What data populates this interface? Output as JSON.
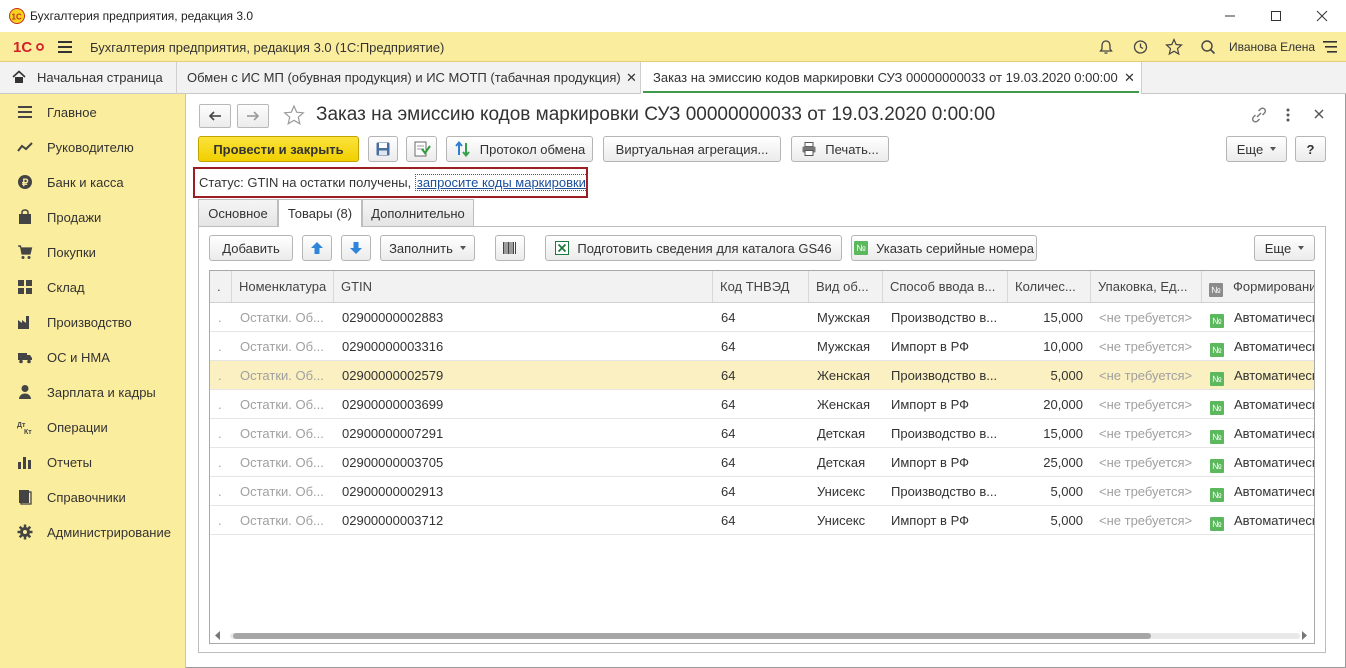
{
  "window": {
    "title": "Бухгалтерия предприятия, редакция 3.0"
  },
  "appbar": {
    "title": "Бухгалтерия предприятия, редакция 3.0  (1С:Предприятие)",
    "user": "Иванова Елена"
  },
  "tabs": [
    {
      "label": "Начальная страница"
    },
    {
      "label": "Обмен с ИС МП (обувная продукция) и ИС МОТП (табачная продукция)"
    },
    {
      "label": "Заказ на эмиссию кодов маркировки СУЗ 00000000033 от 19.03.2020 0:00:00"
    }
  ],
  "sidebar": {
    "items": [
      {
        "label": "Главное",
        "icon": "list-icon"
      },
      {
        "label": "Руководителю",
        "icon": "trend-icon"
      },
      {
        "label": "Банк и касса",
        "icon": "coin-icon"
      },
      {
        "label": "Продажи",
        "icon": "bag-icon"
      },
      {
        "label": "Покупки",
        "icon": "cart-icon"
      },
      {
        "label": "Склад",
        "icon": "grid-icon"
      },
      {
        "label": "Производство",
        "icon": "factory-icon"
      },
      {
        "label": "ОС и НМА",
        "icon": "truck-icon"
      },
      {
        "label": "Зарплата и кадры",
        "icon": "person-icon"
      },
      {
        "label": "Операции",
        "icon": "dt-kt-icon"
      },
      {
        "label": "Отчеты",
        "icon": "bar-chart-icon"
      },
      {
        "label": "Справочники",
        "icon": "book-icon"
      },
      {
        "label": "Администрирование",
        "icon": "gear-icon"
      }
    ]
  },
  "document": {
    "title": "Заказ на эмиссию кодов маркировки СУЗ 00000000033 от 19.03.2020 0:00:00"
  },
  "toolbar": {
    "post_close": "Провести и закрыть",
    "exchange_log": "Протокол обмена",
    "virtual_aggregation": "Виртуальная агрегация...",
    "print": "Печать...",
    "more": "Еще",
    "help": "?"
  },
  "status": {
    "label": "Статус:",
    "text": "GTIN на остатки получены,",
    "link": "запросите коды маркировки"
  },
  "form_tabs": [
    {
      "label": "Основное"
    },
    {
      "label": "Товары (8)"
    },
    {
      "label": "Дополнительно"
    }
  ],
  "goods_toolbar": {
    "add": "Добавить",
    "fill": "Заполнить",
    "prepare_catalog": "Подготовить сведения для каталога GS46",
    "serials": "Указать серийные номера",
    "more": "Еще"
  },
  "table": {
    "columns": [
      ".",
      "Номенклатура",
      "GTIN",
      "Код ТНВЭД",
      "Вид об...",
      "Способ ввода в...",
      "Количес...",
      "Упаковка, Ед...",
      "Формировани"
    ],
    "rows": [
      {
        "marker": ".",
        "nomenclature": "Остатки. Об...",
        "gtin": "02900000002883",
        "tnved": "64",
        "kind": "Мужская",
        "method": "Производство в...",
        "qty": "15,000",
        "pack": "<не требуется>",
        "form": "Автоматическ"
      },
      {
        "marker": ".",
        "nomenclature": "Остатки. Об...",
        "gtin": "02900000003316",
        "tnved": "64",
        "kind": "Мужская",
        "method": "Импорт в РФ",
        "qty": "10,000",
        "pack": "<не требуется>",
        "form": "Автоматическ"
      },
      {
        "marker": ".",
        "nomenclature": "Остатки. Об...",
        "gtin": "02900000002579",
        "tnved": "64",
        "kind": "Женская",
        "method": "Производство в...",
        "qty": "5,000",
        "pack": "<не требуется>",
        "form": "Автоматическ"
      },
      {
        "marker": ".",
        "nomenclature": "Остатки. Об...",
        "gtin": "02900000003699",
        "tnved": "64",
        "kind": "Женская",
        "method": "Импорт в РФ",
        "qty": "20,000",
        "pack": "<не требуется>",
        "form": "Автоматическ"
      },
      {
        "marker": ".",
        "nomenclature": "Остатки. Об...",
        "gtin": "02900000007291",
        "tnved": "64",
        "kind": "Детская",
        "method": "Производство в...",
        "qty": "15,000",
        "pack": "<не требуется>",
        "form": "Автоматическ"
      },
      {
        "marker": ".",
        "nomenclature": "Остатки. Об...",
        "gtin": "02900000003705",
        "tnved": "64",
        "kind": "Детская",
        "method": "Импорт в РФ",
        "qty": "25,000",
        "pack": "<не требуется>",
        "form": "Автоматическ"
      },
      {
        "marker": ".",
        "nomenclature": "Остатки. Об...",
        "gtin": "02900000002913",
        "tnved": "64",
        "kind": "Унисекс",
        "method": "Производство в...",
        "qty": "5,000",
        "pack": "<не требуется>",
        "form": "Автоматическ"
      },
      {
        "marker": ".",
        "nomenclature": "Остатки. Об...",
        "gtin": "02900000003712",
        "tnved": "64",
        "kind": "Унисекс",
        "method": "Импорт в РФ",
        "qty": "5,000",
        "pack": "<не требуется>",
        "form": "Автоматическ"
      }
    ],
    "selected_row": 2
  },
  "colors": {
    "accent_yellow": "#fbed9e",
    "primary_button": "#f4d500",
    "active_tab_line": "#3f9a4e",
    "status_border": "#9c1d24",
    "selected_row": "#fbf0c2"
  }
}
